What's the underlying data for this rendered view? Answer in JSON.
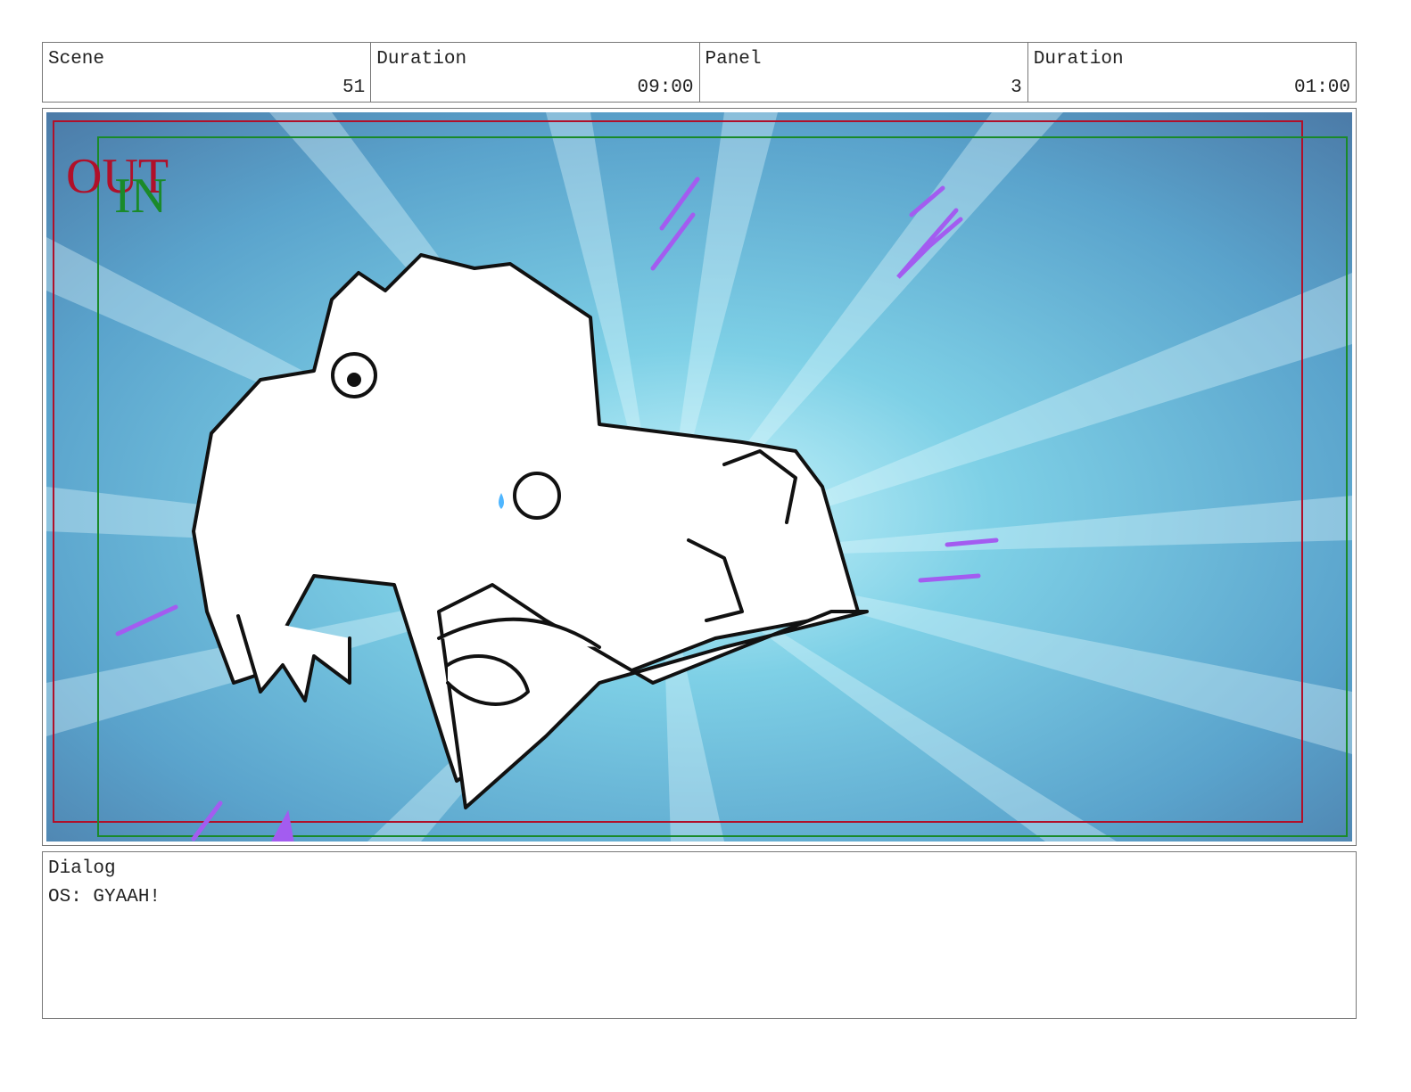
{
  "header": {
    "scene_label": "Scene",
    "scene_value": "51",
    "scene_duration_label": "Duration",
    "scene_duration_value": "09:00",
    "panel_label": "Panel",
    "panel_value": "3",
    "panel_duration_label": "Duration",
    "panel_duration_value": "01:00"
  },
  "panel": {
    "frame_out_label": "OUT",
    "frame_in_label": "IN",
    "frame_out_color": "#b0102a",
    "frame_in_color": "#1a8a2a"
  },
  "dialog": {
    "label": "Dialog",
    "text": "OS: GYAAH!"
  }
}
